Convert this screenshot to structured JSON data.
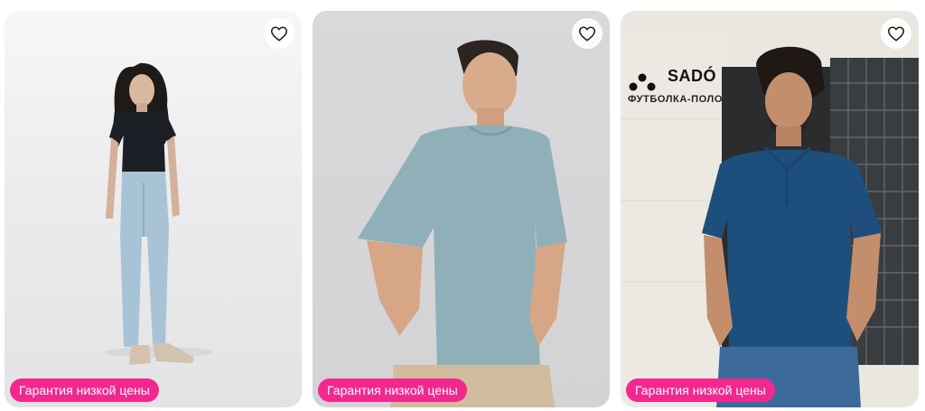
{
  "products": [
    {
      "badge": "Гарантия низкой цены",
      "favorite_icon": "heart-outline-icon"
    },
    {
      "badge": "Гарантия низкой цены",
      "favorite_icon": "heart-outline-icon"
    },
    {
      "badge": "Гарантия низкой цены",
      "favorite_icon": "heart-outline-icon",
      "photo_brand": "SADÓ",
      "photo_caption": "ФУТБОЛКА-ПОЛО"
    }
  ],
  "colors": {
    "badge_bg": "#f3288f",
    "badge_text": "#ffffff",
    "heart_stroke": "#1f1f1f"
  }
}
